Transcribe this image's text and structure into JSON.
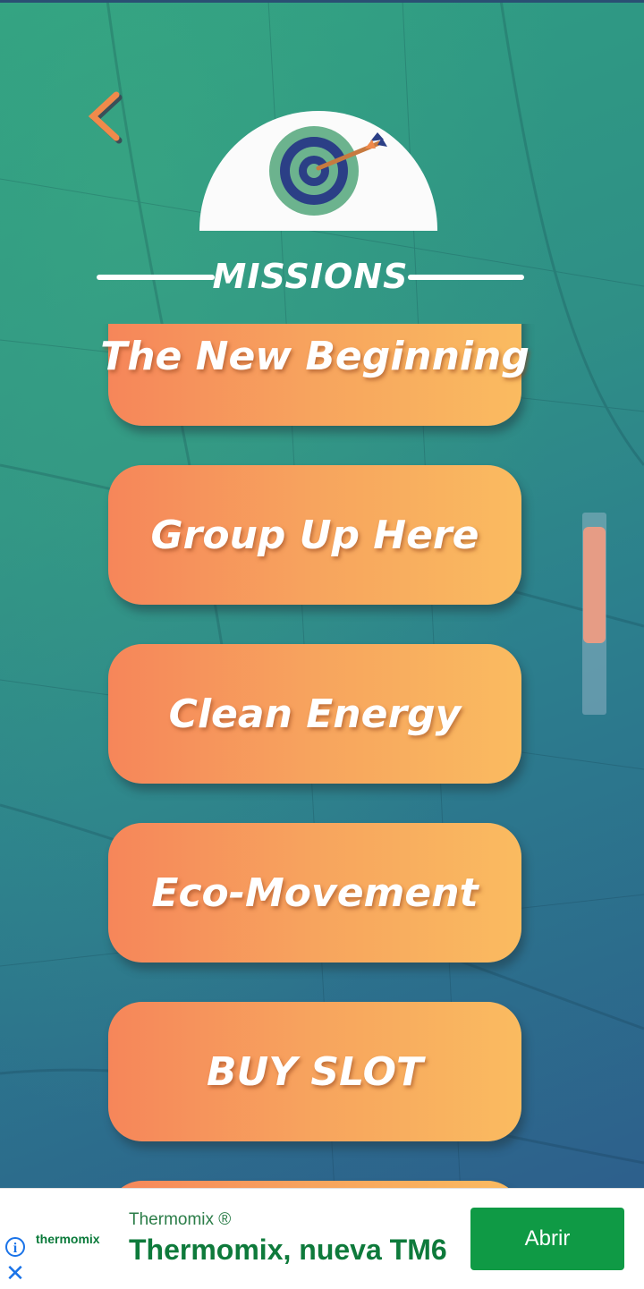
{
  "header": {
    "back_icon": "chevron-left-icon",
    "badge_icon": "target-arrow-icon",
    "title": "MISSIONS"
  },
  "missions": [
    {
      "label": "The New Beginning"
    },
    {
      "label": "Group Up Here"
    },
    {
      "label": "Clean Energy"
    },
    {
      "label": "Eco-Movement"
    },
    {
      "label": "BUY SLOT"
    },
    {
      "label": ""
    }
  ],
  "scrollbar": {
    "position_fraction": 0.07
  },
  "ad": {
    "logo": "thermomix",
    "sponsor": "Thermomix ®",
    "headline": "Thermomix, nueva TM6",
    "cta": "Abrir",
    "info_icon": "info-icon",
    "close_icon": "close-icon"
  },
  "colors": {
    "mission_start": "#f6865a",
    "mission_end": "#fabb60",
    "accent_orange": "#f08a4b",
    "ad_green": "#0f9a45"
  }
}
